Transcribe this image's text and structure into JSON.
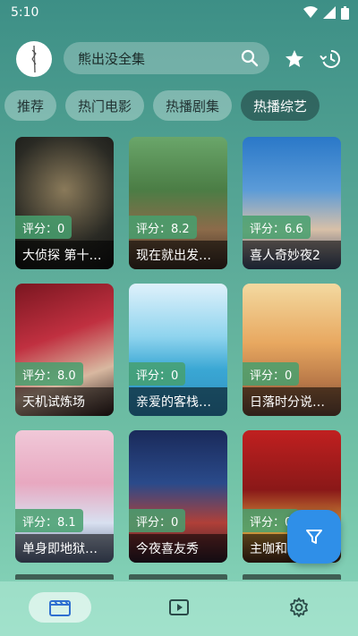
{
  "status": {
    "time": "5:10"
  },
  "search": {
    "placeholder": "熊出没全集",
    "value": "熊出没全集"
  },
  "tabs": [
    {
      "label": "推荐",
      "active": false
    },
    {
      "label": "热门电影",
      "active": false
    },
    {
      "label": "热播剧集",
      "active": false
    },
    {
      "label": "热播综艺",
      "active": true
    }
  ],
  "cards": [
    {
      "title": "大侦探 第十…",
      "score": "评分：0"
    },
    {
      "title": "现在就出发…",
      "score": "评分：8.2"
    },
    {
      "title": "喜人奇妙夜2",
      "score": "评分：6.6"
    },
    {
      "title": "天机试炼场",
      "score": "评分：8.0"
    },
    {
      "title": "亲爱的客栈…",
      "score": "评分：0"
    },
    {
      "title": "日落时分说…",
      "score": "评分：0"
    },
    {
      "title": "单身即地狱…",
      "score": "评分：8.1"
    },
    {
      "title": "今夜喜友秀",
      "score": "评分：0"
    },
    {
      "title": "主咖和…",
      "score": "评分：0"
    }
  ],
  "icons": {
    "search": "search-icon",
    "star": "star-icon",
    "history": "history-icon",
    "filter": "filter-icon",
    "movie": "film-icon",
    "play": "play-icon",
    "settings": "gear-icon"
  },
  "colors": {
    "accent": "#2f8fe8",
    "score_bg": "#46a06e"
  }
}
